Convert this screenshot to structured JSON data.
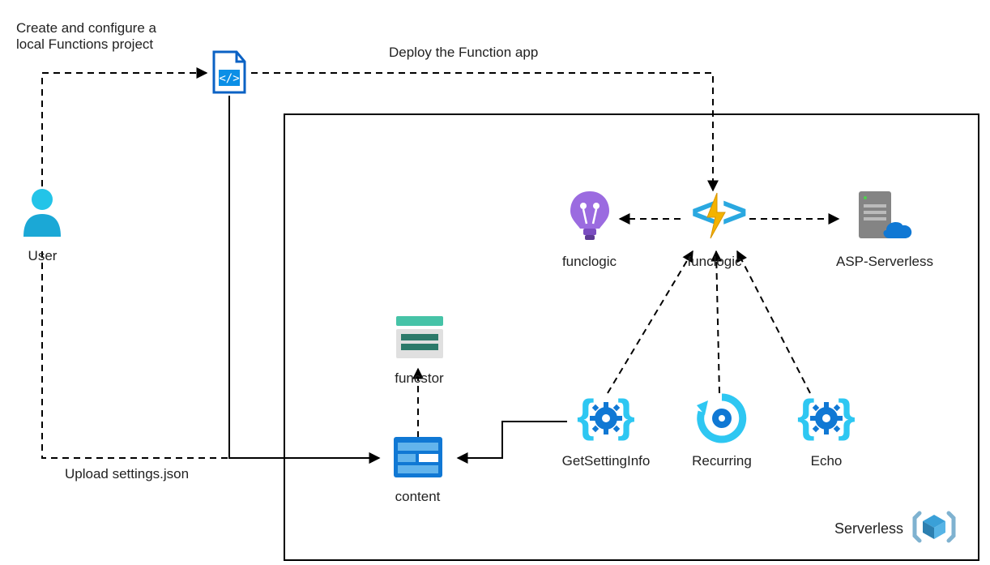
{
  "annotations": {
    "create_project": "Create and configure a\nlocal Functions project",
    "deploy": "Deploy the Function app",
    "upload": "Upload settings.json"
  },
  "nodes": {
    "user": "User",
    "funclogic_insights": "funclogic",
    "funclogic_app": "funclogic",
    "asp": "ASP-Serverless",
    "funcstor": "funcstor",
    "content": "content",
    "getsetting": "GetSettingInfo",
    "recurring": "Recurring",
    "echo": "Echo",
    "serverless_group": "Serverless"
  }
}
